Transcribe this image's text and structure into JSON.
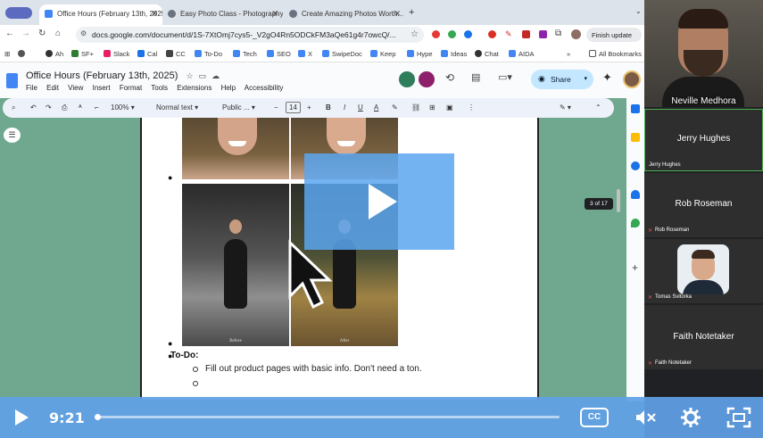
{
  "browser": {
    "tabs": [
      {
        "title": "Office Hours (February 13th, 2025)",
        "active": true
      },
      {
        "title": "Easy Photo Class - Photography",
        "active": false
      },
      {
        "title": "Create Amazing Photos Worth...",
        "active": false
      }
    ],
    "url": "docs.google.com/document/d/1S-7XtOmj7cys5-_V2gO4Rn5ODCkFM3aQe61g4r7owcQ/...",
    "update_label": "Finish update",
    "bookmarks": [
      "Ah",
      "SF+",
      "Slack",
      "Cal",
      "CC",
      "To-Do",
      "Tech",
      "SEO",
      "X",
      "SwipeDoc",
      "Keep",
      "Hype",
      "Ideas",
      "Chat",
      "AIDA"
    ],
    "all_bookmarks": "All Bookmarks"
  },
  "doc": {
    "title": "Office Hours (February 13th, 2025)",
    "menus": [
      "File",
      "Edit",
      "View",
      "Insert",
      "Format",
      "Tools",
      "Extensions",
      "Help",
      "Accessibility"
    ],
    "share_label": "Share",
    "zoom": "100%",
    "style": "Normal text",
    "font": "Public ...",
    "font_size": "14",
    "todo_heading": "To-Do:",
    "todo_items": [
      "Fill out product pages with basic info. Don't need a ton.",
      ""
    ],
    "photo_captions": [
      "Before",
      "After"
    ],
    "page_indicator": "3 of 17"
  },
  "meet": {
    "speaker": "Neville Medhora",
    "participants": [
      {
        "name": "Jerry Hughes",
        "label": "Jerry Hughes",
        "has_video": false
      },
      {
        "name": "Rob Roseman",
        "label": "Rob Roseman",
        "has_video": false
      },
      {
        "name": "Tomas Svitorka",
        "label": "Tomas Svitorka",
        "has_video": true
      },
      {
        "name": "Faith Notetaker",
        "label": "Faith Notetaker",
        "has_video": false
      }
    ]
  },
  "player": {
    "time": "9:21",
    "progress": 0.0
  },
  "colors": {
    "player_blue": "#60a0e6",
    "doc_bg": "#6fa88e",
    "share_bg": "#c2e7ff"
  }
}
